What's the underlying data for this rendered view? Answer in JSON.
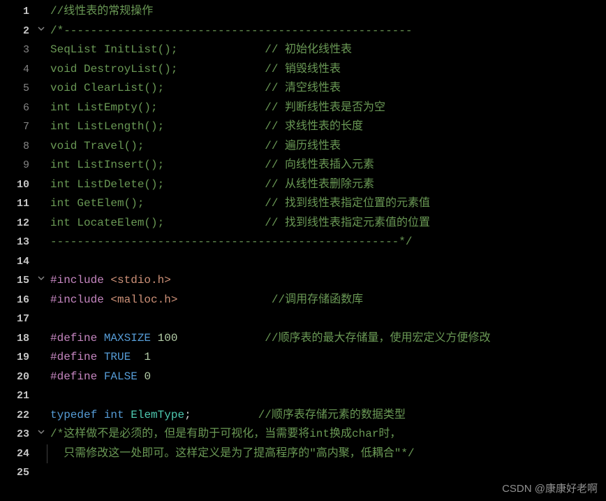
{
  "watermark": "CSDN @康康好老啊",
  "lines": [
    {
      "num": "1",
      "bold": true,
      "fold": "",
      "border": false,
      "tokens": [
        [
          "comment",
          "//线性表的常规操作"
        ]
      ]
    },
    {
      "num": "2",
      "bold": true,
      "fold": "v",
      "border": false,
      "tokens": [
        [
          "comment",
          "/*----------------------------------------------------"
        ]
      ]
    },
    {
      "num": "3",
      "bold": false,
      "fold": "",
      "border": false,
      "tokens": [
        [
          "comment",
          "SeqList InitList();             // 初始化线性表"
        ]
      ]
    },
    {
      "num": "4",
      "bold": false,
      "fold": "",
      "border": false,
      "tokens": [
        [
          "comment",
          "void DestroyList();             // 销毁线性表"
        ]
      ]
    },
    {
      "num": "5",
      "bold": false,
      "fold": "",
      "border": false,
      "tokens": [
        [
          "comment",
          "void ClearList();               // 清空线性表"
        ]
      ]
    },
    {
      "num": "6",
      "bold": false,
      "fold": "",
      "border": false,
      "tokens": [
        [
          "comment",
          "int ListEmpty();                // 判断线性表是否为空"
        ]
      ]
    },
    {
      "num": "7",
      "bold": false,
      "fold": "",
      "border": false,
      "tokens": [
        [
          "comment",
          "int ListLength();               // 求线性表的长度"
        ]
      ]
    },
    {
      "num": "8",
      "bold": false,
      "fold": "",
      "border": false,
      "tokens": [
        [
          "comment",
          "void Travel();                  // 遍历线性表"
        ]
      ]
    },
    {
      "num": "9",
      "bold": false,
      "fold": "",
      "border": false,
      "tokens": [
        [
          "comment",
          "int ListInsert();               // 向线性表插入元素"
        ]
      ]
    },
    {
      "num": "10",
      "bold": true,
      "fold": "",
      "border": false,
      "tokens": [
        [
          "comment",
          "int ListDelete();               // 从线性表删除元素"
        ]
      ]
    },
    {
      "num": "11",
      "bold": true,
      "fold": "",
      "border": false,
      "tokens": [
        [
          "comment",
          "int GetElem();                  // 找到线性表指定位置的元素值"
        ]
      ]
    },
    {
      "num": "12",
      "bold": true,
      "fold": "",
      "border": false,
      "tokens": [
        [
          "comment",
          "int LocateElem();               // 找到线性表指定元素值的位置"
        ]
      ]
    },
    {
      "num": "13",
      "bold": true,
      "fold": "",
      "border": false,
      "tokens": [
        [
          "comment",
          "----------------------------------------------------*/"
        ]
      ]
    },
    {
      "num": "14",
      "bold": true,
      "fold": "",
      "border": false,
      "tokens": [
        [
          "white",
          ""
        ]
      ]
    },
    {
      "num": "15",
      "bold": true,
      "fold": "v",
      "border": false,
      "tokens": [
        [
          "preproc",
          "#include "
        ],
        [
          "string",
          "<stdio.h>"
        ]
      ]
    },
    {
      "num": "16",
      "bold": true,
      "fold": "",
      "border": false,
      "tokens": [
        [
          "preproc",
          "#include "
        ],
        [
          "string",
          "<malloc.h>"
        ],
        [
          "white",
          "              "
        ],
        [
          "comment",
          "//调用存储函数库"
        ]
      ]
    },
    {
      "num": "17",
      "bold": true,
      "fold": "",
      "border": false,
      "tokens": [
        [
          "white",
          ""
        ]
      ]
    },
    {
      "num": "18",
      "bold": true,
      "fold": "",
      "border": false,
      "tokens": [
        [
          "preproc",
          "#define "
        ],
        [
          "macro",
          "MAXSIZE"
        ],
        [
          "white",
          " "
        ],
        [
          "number",
          "100"
        ],
        [
          "white",
          "             "
        ],
        [
          "comment",
          "//顺序表的最大存储量，使用宏定义方便修改"
        ]
      ]
    },
    {
      "num": "19",
      "bold": true,
      "fold": "",
      "border": false,
      "tokens": [
        [
          "preproc",
          "#define "
        ],
        [
          "macro",
          "TRUE"
        ],
        [
          "white",
          "  "
        ],
        [
          "number",
          "1"
        ]
      ]
    },
    {
      "num": "20",
      "bold": true,
      "fold": "",
      "border": false,
      "tokens": [
        [
          "preproc",
          "#define "
        ],
        [
          "macro",
          "FALSE"
        ],
        [
          "white",
          " "
        ],
        [
          "number",
          "0"
        ]
      ]
    },
    {
      "num": "21",
      "bold": true,
      "fold": "",
      "border": false,
      "tokens": [
        [
          "white",
          ""
        ]
      ]
    },
    {
      "num": "22",
      "bold": true,
      "fold": "",
      "border": false,
      "tokens": [
        [
          "type",
          "typedef"
        ],
        [
          "white",
          " "
        ],
        [
          "type",
          "int"
        ],
        [
          "white",
          " "
        ],
        [
          "typename",
          "ElemType"
        ],
        [
          "punct",
          ";"
        ],
        [
          "white",
          "          "
        ],
        [
          "comment",
          "//顺序表存储元素的数据类型"
        ]
      ]
    },
    {
      "num": "23",
      "bold": true,
      "fold": "v",
      "border": false,
      "tokens": [
        [
          "comment",
          "/*这样做不是必须的，但是有助于可视化，当需要将int换成char时，"
        ]
      ]
    },
    {
      "num": "24",
      "bold": true,
      "fold": "",
      "border": true,
      "tokens": [
        [
          "comment",
          "  只需修改这一处即可。这样定义是为了提高程序的\"高内聚，低耦合\"*/"
        ]
      ]
    },
    {
      "num": "25",
      "bold": true,
      "fold": "",
      "border": false,
      "tokens": [
        [
          "white",
          ""
        ]
      ]
    }
  ]
}
